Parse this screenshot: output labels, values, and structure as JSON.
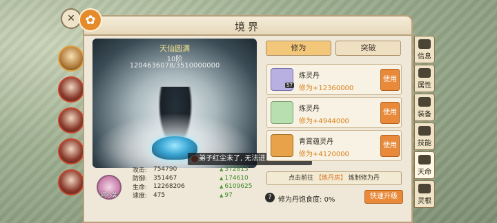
{
  "panel": {
    "title": "境界"
  },
  "realm": {
    "name": "天仙圆满",
    "level": "10阶",
    "progress": "1204636078/3510000000"
  },
  "toast": {
    "text": "弟子红尘未了, 无法进入问心关"
  },
  "stats": [
    {
      "label": "攻击:",
      "value": "754790",
      "bonus": "372813"
    },
    {
      "label": "防御:",
      "value": "351467",
      "bonus": "174610"
    },
    {
      "label": "生命:",
      "value": "12268206",
      "bonus": "6109625"
    },
    {
      "label": "速度:",
      "value": "475",
      "bonus": "97"
    }
  ],
  "heart_gate": {
    "label": "问心关"
  },
  "tabs": {
    "cultivation": "修为",
    "breakthrough": "突破"
  },
  "items": [
    {
      "name": "炼灵丹",
      "effect": "修为+12360000",
      "count": "57",
      "use": "使用"
    },
    {
      "name": "炼灵丹",
      "effect": "修为+4944000",
      "count": "",
      "use": "使用"
    },
    {
      "name": "青霄蕴灵丹",
      "effect": "修为+4120000",
      "count": "",
      "use": "使用"
    }
  ],
  "hint": {
    "prefix": "点击前往",
    "link": "【炼丹房】",
    "suffix": "炼制修为丹"
  },
  "satiety": {
    "label": "修为丹饱食度:",
    "value": "0%"
  },
  "quick_upgrade": "快速升级",
  "side_tabs": [
    "信息",
    "属性",
    "装备",
    "技能",
    "天命",
    "灵根"
  ]
}
